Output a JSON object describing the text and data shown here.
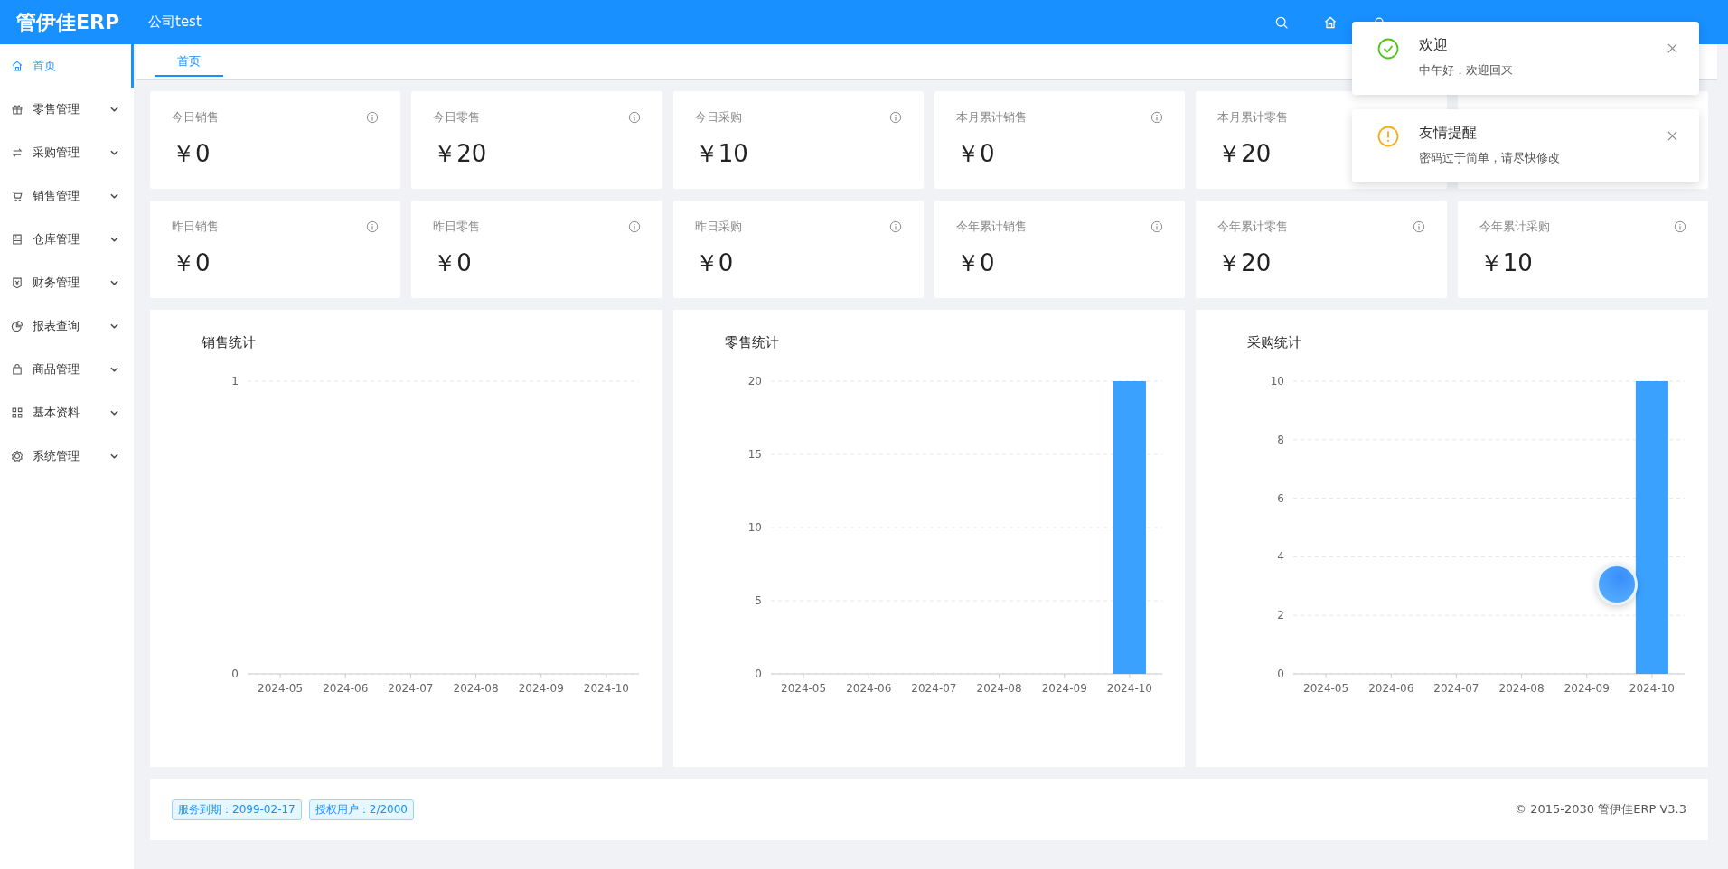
{
  "header": {
    "logo": "管伊佳ERP",
    "company": "公司test"
  },
  "sidebar": {
    "items": [
      {
        "label": "首页",
        "kind": "link",
        "selected": true
      },
      {
        "label": "零售管理",
        "kind": "submenu",
        "selected": false
      },
      {
        "label": "采购管理",
        "kind": "submenu",
        "selected": false
      },
      {
        "label": "销售管理",
        "kind": "submenu",
        "selected": false
      },
      {
        "label": "仓库管理",
        "kind": "submenu",
        "selected": false
      },
      {
        "label": "财务管理",
        "kind": "submenu",
        "selected": false
      },
      {
        "label": "报表查询",
        "kind": "submenu",
        "selected": false
      },
      {
        "label": "商品管理",
        "kind": "submenu",
        "selected": false
      },
      {
        "label": "基本资料",
        "kind": "submenu",
        "selected": false
      },
      {
        "label": "系统管理",
        "kind": "submenu",
        "selected": false
      }
    ]
  },
  "tabs": [
    {
      "label": "首页",
      "selected": true
    }
  ],
  "stats": [
    [
      {
        "kind": "stat",
        "label": "今日销售",
        "value": "￥0"
      },
      {
        "kind": "stat",
        "label": "今日零售",
        "value": "￥20"
      },
      {
        "kind": "stat",
        "label": "今日采购",
        "value": "￥10"
      },
      {
        "kind": "stat",
        "label": "本月累计销售",
        "value": "￥0"
      },
      {
        "kind": "partial",
        "label": "本月累计零售",
        "value": "￥20"
      },
      {
        "kind": "covered"
      }
    ],
    [
      {
        "kind": "stat",
        "label": "昨日销售",
        "value": "￥0"
      },
      {
        "kind": "stat",
        "label": "昨日零售",
        "value": "￥0"
      },
      {
        "kind": "stat",
        "label": "昨日采购",
        "value": "￥0"
      },
      {
        "kind": "stat",
        "label": "今年累计销售",
        "value": "￥0"
      },
      {
        "kind": "stat",
        "label": "今年累计零售",
        "value": "￥20"
      },
      {
        "kind": "stat",
        "label": "今年累计采购",
        "value": "￥10"
      }
    ]
  ],
  "charts": [
    {
      "chart_data": {
        "type": "bar",
        "title": "销售统计",
        "categories": [
          "2024-05",
          "2024-06",
          "2024-07",
          "2024-08",
          "2024-09",
          "2024-10"
        ],
        "series": [
          {
            "values": [
              0,
              0,
              0,
              0,
              0,
              0
            ]
          }
        ],
        "ylim": [
          0,
          1
        ],
        "yticks": [
          0,
          1
        ],
        "grid": true
      }
    },
    {
      "chart_data": {
        "type": "bar",
        "title": "零售统计",
        "categories": [
          "2024-05",
          "2024-06",
          "2024-07",
          "2024-08",
          "2024-09",
          "2024-10"
        ],
        "series": [
          {
            "color": "#3ba1ff",
            "values": [
              0,
              0,
              0,
              0,
              0,
              20
            ]
          }
        ],
        "ylim": [
          0,
          20
        ],
        "yticks": [
          0,
          5,
          10,
          15,
          20
        ],
        "grid": true
      }
    },
    {
      "chart_data": {
        "type": "bar",
        "title": "采购统计",
        "categories": [
          "2024-05",
          "2024-06",
          "2024-07",
          "2024-08",
          "2024-09",
          "2024-10"
        ],
        "series": [
          {
            "color": "#3ba1ff",
            "values": [
              0,
              0,
              0,
              0,
              0,
              10
            ]
          }
        ],
        "ylim": [
          0,
          10
        ],
        "yticks": [
          0,
          2,
          4,
          6,
          8,
          10
        ],
        "grid": true
      }
    }
  ],
  "footer": {
    "tags": [
      "服务到期：2099-02-17",
      "授权用户：2/2000"
    ],
    "copyright": "© 2015-2030 管伊佳ERP V3.3"
  },
  "notifications": [
    {
      "kind": "success",
      "title": "欢迎",
      "message": "中午好，欢迎回来"
    },
    {
      "kind": "warning",
      "title": "友情提醒",
      "message": "密码过于简单，请尽快修改"
    }
  ]
}
